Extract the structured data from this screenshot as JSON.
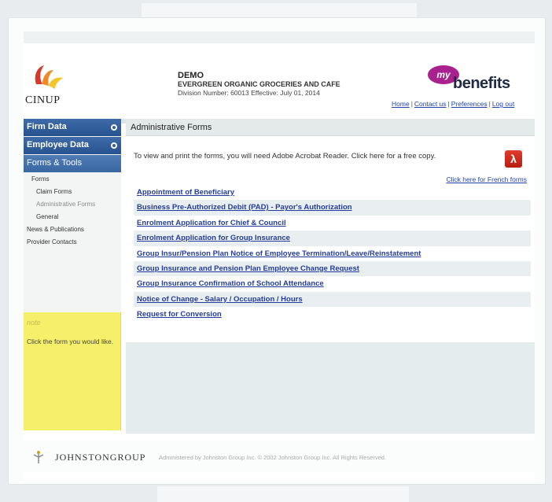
{
  "brand": {
    "cinup": "CINUP",
    "my": "my",
    "benefits": "benefits"
  },
  "header": {
    "demo": "DEMO",
    "company": "EVERGREEN ORGANIC GROCERIES AND CAFE",
    "division": "Division Number: 60013 Effective: July 01, 2014",
    "links": [
      "Home",
      "Contact us",
      "Preferences",
      "Log out"
    ]
  },
  "sidebar": {
    "main": [
      "Firm Data",
      "Employee Data",
      "Forms & Tools"
    ],
    "sub": [
      "Forms",
      "Claim Forms",
      "Administrative Forms",
      "General",
      "News & Publications",
      "Provider Contacts"
    ]
  },
  "note": {
    "title": "note",
    "body": "Click the form you would like."
  },
  "content": {
    "title": "Administrative Forms",
    "intro": "To view and print the forms, you will need Adobe Acrobat Reader. Click here for a free copy.",
    "french_link": "Click here for French forms",
    "forms": [
      "Appointment of Beneficiary",
      "Business Pre-Authorized Debit (PAD) - Payor's Authorization",
      "Enrolment Application for Chief & Council",
      "Enrolment Application for Group Insurance",
      "Group Insur/Pension Plan Notice of Employee Termination/Leave/Reinstatement",
      "Group Insurance and Pension Plan Employee Change Request",
      "Group Insurance Confirmation of School Attendance",
      "Notice of Change - Salary / Occupation / Hours",
      "Request for Conversion"
    ]
  },
  "footer": {
    "brand": "JOHNSTONGROUP",
    "copyright": "Administered by Johnston Group Inc. © 2002 Johnston Group Inc. All Rights Reserved."
  },
  "colors": {
    "nav_blue": "#2c5a98",
    "link_blue": "#243c9c",
    "note_yellow": "#f6ef6a",
    "pdf_red": "#d12a1c",
    "brand_purple": "#a8218e"
  }
}
